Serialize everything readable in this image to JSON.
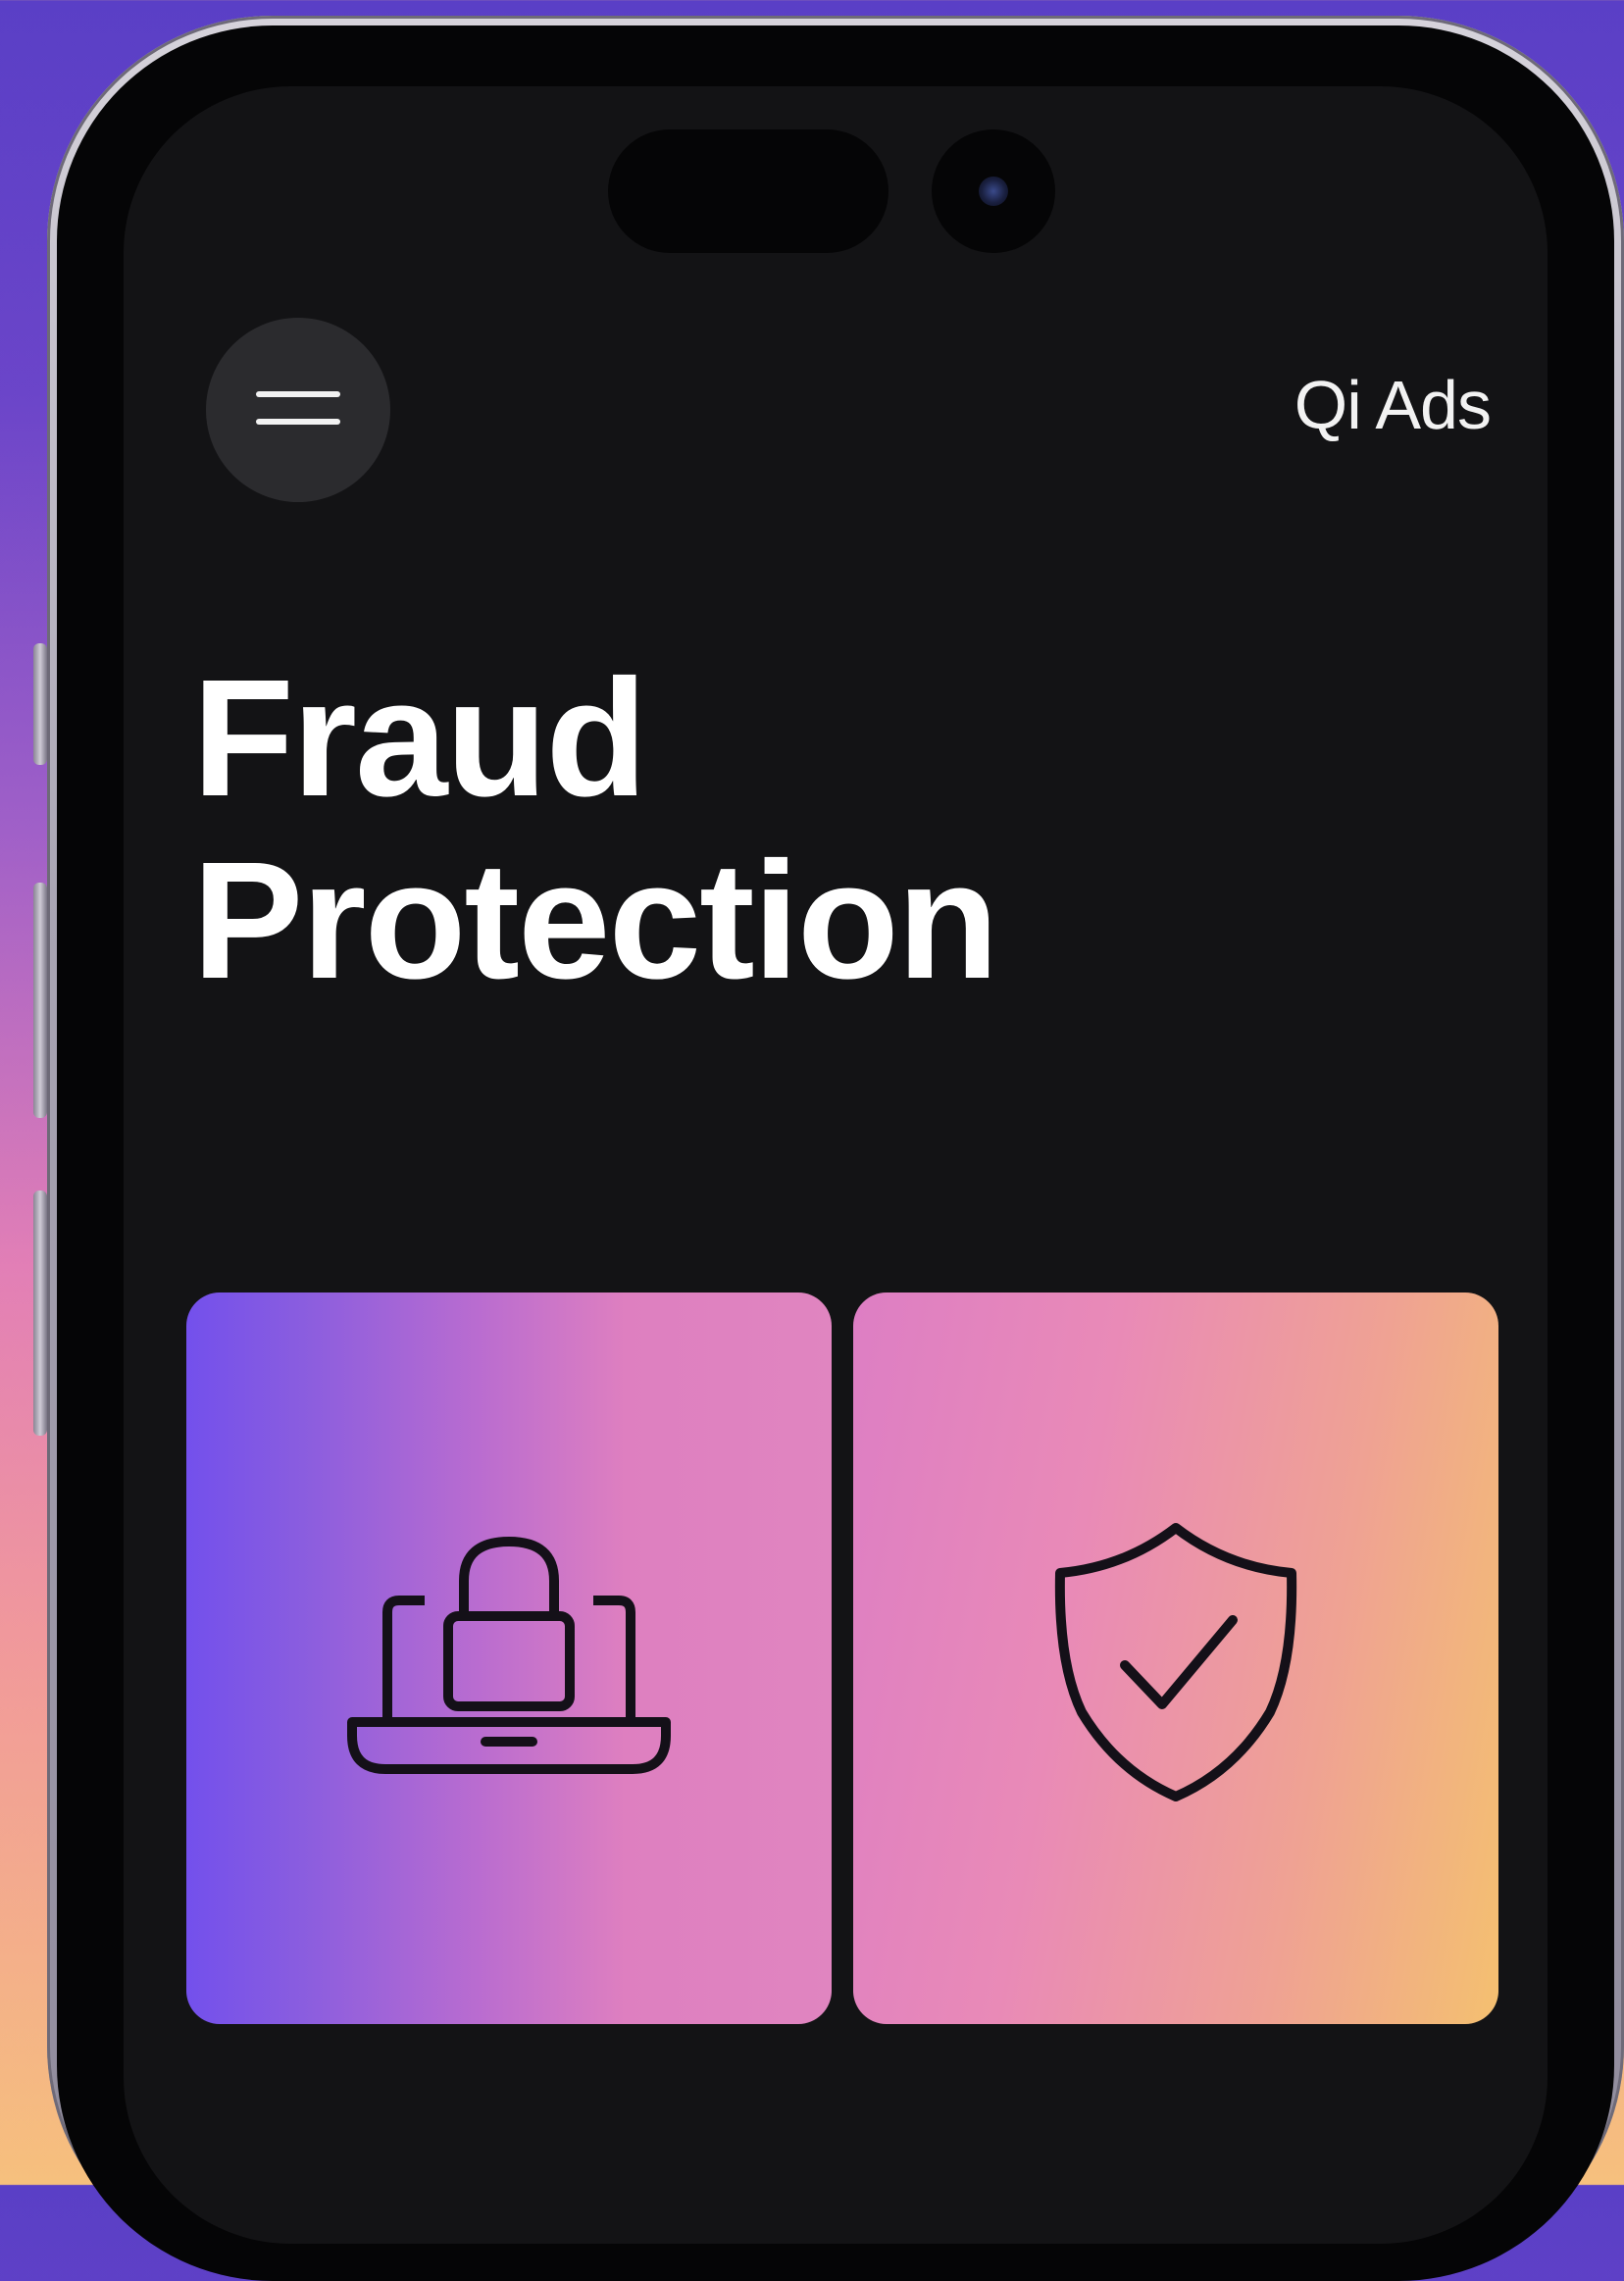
{
  "header": {
    "menu_icon": "hamburger-menu-icon",
    "brand": "Qi Ads"
  },
  "hero": {
    "title_line1": "Fraud",
    "title_line2": "Protection"
  },
  "cards": [
    {
      "icon": "laptop-lock-icon",
      "gradient": [
        "#7350ec",
        "#de7fc0"
      ]
    },
    {
      "icon": "shield-check-icon",
      "gradient": [
        "#dd7ec4",
        "#f4c070"
      ]
    }
  ],
  "colors": {
    "background_gradient": [
      "#5a3fc6",
      "#e27fb6",
      "#f6c07d"
    ],
    "screen": "#131315",
    "menu_button": "#2b2b2e",
    "text": "#ffffff"
  }
}
